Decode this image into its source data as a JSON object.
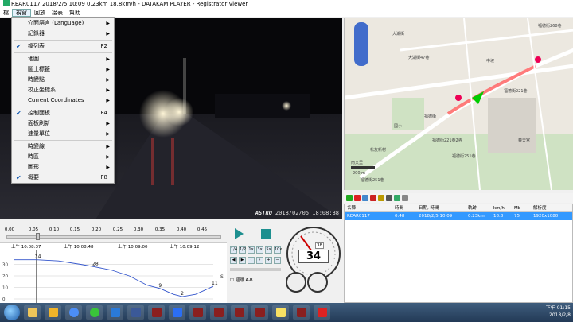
{
  "window": {
    "title": "REAR0117     2018/2/5 10:09     0.23km     18.8km/h  -  DATAKAM PLAYER - Registrator Viewer"
  },
  "menubar": [
    "檔",
    "視窗",
    "回放",
    "接表",
    "幫助"
  ],
  "dropdown": [
    {
      "label": "介面語言 (Language)",
      "arrow": true
    },
    {
      "label": "記錄器",
      "arrow": true
    },
    {
      "sep": true
    },
    {
      "label": "檔列表",
      "checked": true,
      "shortcut": "F2"
    },
    {
      "sep": true
    },
    {
      "label": "地圖",
      "arrow": true
    },
    {
      "label": "圖上標籤",
      "arrow": true
    },
    {
      "label": "時變點",
      "arrow": true
    },
    {
      "label": "校正坐標系",
      "arrow": true
    },
    {
      "label": "Current Coordinates",
      "arrow": true
    },
    {
      "sep": true
    },
    {
      "label": "控制面板",
      "checked": true,
      "shortcut": "F4"
    },
    {
      "label": "面板刷新",
      "arrow": true
    },
    {
      "label": "速量單位",
      "arrow": true
    },
    {
      "sep": true
    },
    {
      "label": "時變線",
      "arrow": true
    },
    {
      "label": "時區",
      "arrow": true
    },
    {
      "label": "圖形",
      "arrow": true
    },
    {
      "label": "概要",
      "checked": true,
      "shortcut": "F8"
    }
  ],
  "video": {
    "brand": "ASTRO",
    "brand_suffix": "timz",
    "timestamp": "2018/02/05 18:08:38"
  },
  "map": {
    "labels": [
      "大湖街",
      "大湖街47巷",
      "福德街221巷",
      "福德街268巷",
      "福德街",
      "福德街221巷2弄",
      "南文里",
      "松友新村",
      "福德街251巷",
      "福德街251巷",
      "中坡",
      "200 m",
      "國小",
      "春天宮"
    ]
  },
  "table": {
    "headers": [
      "名陣",
      "時間",
      "日期, 時間",
      "軌跡",
      "km/h",
      "Mb",
      "解析度"
    ],
    "row": [
      "REAR0117",
      "0:48",
      "2018/2/5 10:09",
      "0.23km",
      "18.8",
      "75",
      "1920x1080"
    ]
  },
  "timeaxis": {
    "ticks": [
      "0.00",
      "0.05",
      "0.10",
      "0.15",
      "0.20",
      "0.25",
      "0.30",
      "0.35",
      "0.40",
      "0.45"
    ]
  },
  "graph": {
    "times": [
      "上午 10:08:37",
      "上午 10:08:48",
      "上午 10:09:00",
      "上午 10:09:12"
    ],
    "ylabels": [
      "30",
      "20",
      "10",
      "0"
    ],
    "side_label": "S",
    "points": [
      {
        "x": 0,
        "y": 34
      },
      {
        "x": 0.05,
        "y": 34
      },
      {
        "x": 0.1,
        "y": 33
      },
      {
        "x": 0.15,
        "y": 30
      },
      {
        "x": 0.18,
        "y": 28
      },
      {
        "x": 0.22,
        "y": 25
      },
      {
        "x": 0.26,
        "y": 20
      },
      {
        "x": 0.3,
        "y": 12
      },
      {
        "x": 0.33,
        "y": 9
      },
      {
        "x": 0.36,
        "y": 4
      },
      {
        "x": 0.38,
        "y": 2
      },
      {
        "x": 0.41,
        "y": 4
      },
      {
        "x": 0.45,
        "y": 11
      }
    ],
    "labels": [
      "34",
      "28",
      "9",
      "2",
      "11"
    ]
  },
  "controls": {
    "speed": "34",
    "speed_limit": "38",
    "ab_label": "週環 A-B",
    "buttons": [
      "1/4",
      "1/2",
      "1x",
      "3x",
      "5x",
      "10x"
    ]
  },
  "taskbar": {
    "time": "下午 01:15",
    "date": "2018/2/8"
  }
}
